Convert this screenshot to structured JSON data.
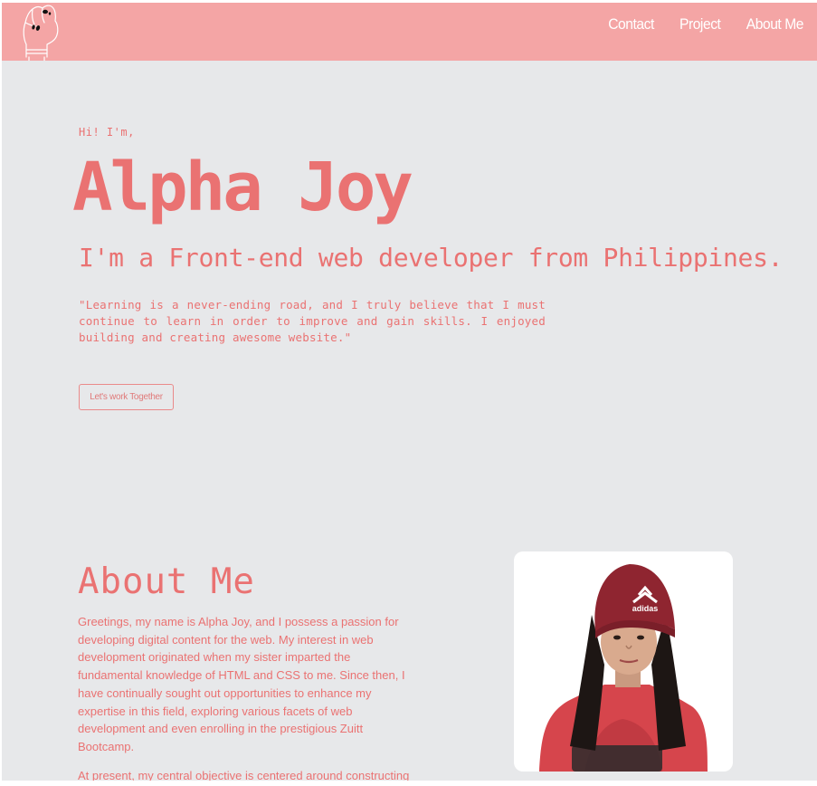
{
  "header": {
    "logo_icon": "hand-drawing-logo",
    "nav": [
      "Contact",
      "Project",
      "About Me"
    ]
  },
  "hero": {
    "greeting": "Hi! I'm,",
    "name": "Alpha Joy",
    "tagline": "I'm a Front-end web developer from Philippines.",
    "quote": "\"Learning is a never-ending road, and I truly believe that I must continue to learn in order to improve and gain skills. I enjoyed building and creating awesome website.\"",
    "cta_label": "Let's work Together"
  },
  "about": {
    "title": "About Me",
    "paragraph1": "Greetings, my name is Alpha Joy, and I possess a passion for developing digital content for the web. My interest in web development originated when my sister imparted the fundamental knowledge of HTML and CSS to me. Since then, I have continually sought out opportunities to enhance my expertise in this field, exploring various facets of web development and even enrolling in the prestigious Zuitt Bootcamp.",
    "paragraph2": "At present, my central objective is centered around constructing"
  },
  "colors": {
    "header_bg": "#f4a5a5",
    "page_bg": "#e7e8ea",
    "accent": "#ea7272"
  }
}
